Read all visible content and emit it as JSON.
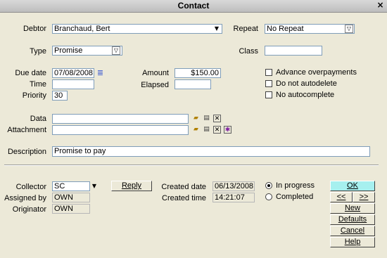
{
  "window": {
    "title": "Contact",
    "close": "×"
  },
  "debtor": {
    "label": "Debtor",
    "value": "Branchaud, Bert"
  },
  "repeat": {
    "label": "Repeat",
    "value": "No Repeat"
  },
  "type": {
    "label": "Type",
    "value": "Promise"
  },
  "class": {
    "label": "Class",
    "value": ""
  },
  "due_date": {
    "label": "Due date",
    "value": "07/08/2008"
  },
  "time": {
    "label": "Time",
    "value": ""
  },
  "priority": {
    "label": "Priority",
    "value": "30"
  },
  "amount": {
    "label": "Amount",
    "value": "$150.00"
  },
  "elapsed": {
    "label": "Elapsed",
    "value": ""
  },
  "checkboxes": [
    {
      "label": "Advance overpayments",
      "checked": false
    },
    {
      "label": "Do not autodelete",
      "checked": false
    },
    {
      "label": "No autocomplete",
      "checked": false
    }
  ],
  "data_field": {
    "label": "Data",
    "value": ""
  },
  "attachment": {
    "label": "Attachment",
    "value": ""
  },
  "description": {
    "label": "Description",
    "value": "Promise to pay"
  },
  "collector": {
    "label": "Collector",
    "value": "SC"
  },
  "assigned_by": {
    "label": "Assigned by",
    "value": "OWN"
  },
  "originator": {
    "label": "Originator",
    "value": "OWN"
  },
  "reply_button": "Reply",
  "created_date": {
    "label": "Created date",
    "value": "06/13/2008"
  },
  "created_time": {
    "label": "Created time",
    "value": "14:21:07"
  },
  "status": {
    "options": [
      {
        "label": "In progress",
        "selected": true
      },
      {
        "label": "Completed",
        "selected": false
      }
    ]
  },
  "buttons": {
    "ok": "OK",
    "prev": "<<",
    "next": ">>",
    "new": "New",
    "defaults": "Defaults",
    "cancel": "Cancel",
    "help": "Help"
  },
  "icons": {
    "calendar": "calendar-icon",
    "open_folder": "open-folder-icon",
    "print": "print-icon",
    "delete": "delete-icon",
    "scan": "scan-icon"
  },
  "colors": {
    "ok_button": "#a6f0ef",
    "window_bg": "#ece9d8",
    "calendar_icon": "#3050d0"
  }
}
